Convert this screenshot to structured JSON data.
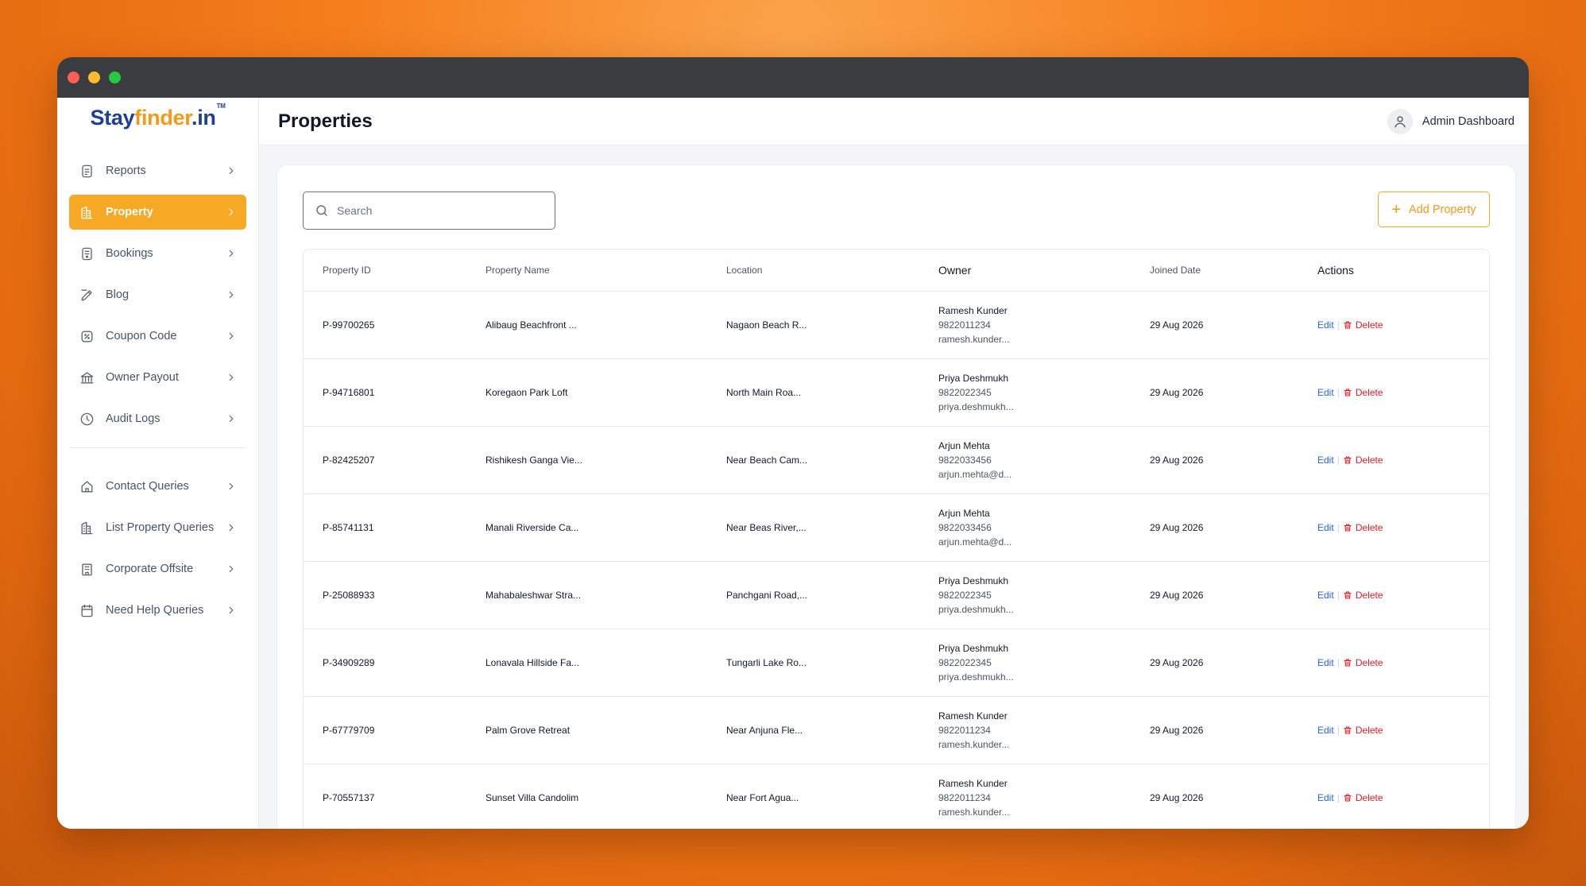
{
  "brand": {
    "part1": "Stay",
    "part2": "finder",
    "part3": ".in",
    "tm": "TM"
  },
  "sidebar": {
    "items": [
      {
        "label": "Reports",
        "icon": "report-icon"
      },
      {
        "label": "Property",
        "icon": "building-icon",
        "active": true
      },
      {
        "label": "Bookings",
        "icon": "booking-icon"
      },
      {
        "label": "Blog",
        "icon": "pen-icon"
      },
      {
        "label": "Coupon Code",
        "icon": "percent-icon"
      },
      {
        "label": "Owner Payout",
        "icon": "payout-icon"
      },
      {
        "label": "Audit Logs",
        "icon": "clock-icon"
      }
    ],
    "items2": [
      {
        "label": "Contact Queries",
        "icon": "home-icon"
      },
      {
        "label": "List Property Queries",
        "icon": "building-icon"
      },
      {
        "label": "Corporate Offsite",
        "icon": "office-icon"
      },
      {
        "label": "Need Help Queries",
        "icon": "calendar-icon"
      }
    ]
  },
  "header": {
    "title": "Properties",
    "user_label": "Admin Dashboard"
  },
  "search": {
    "placeholder": "Search"
  },
  "add_button": {
    "label": "Add Property"
  },
  "table": {
    "headers": [
      "Property ID",
      "Property Name",
      "Location",
      "Owner",
      "Joined Date",
      "Actions"
    ],
    "edit_label": "Edit",
    "sep": "|",
    "delete_label": "Delete",
    "rows": [
      {
        "id": "P-99700265",
        "name": "Alibaug Beachfront ...",
        "location": "Nagaon Beach R...",
        "owner": "Ramesh Kunder",
        "phone": "9822011234",
        "email": "ramesh.kunder...",
        "date": "29 Aug 2026"
      },
      {
        "id": "P-94716801",
        "name": "Koregaon Park Loft",
        "location": "North Main Roa...",
        "owner": "Priya Deshmukh",
        "phone": "9822022345",
        "email": "priya.deshmukh...",
        "date": "29 Aug 2026"
      },
      {
        "id": "P-82425207",
        "name": "Rishikesh Ganga Vie...",
        "location": "Near Beach Cam...",
        "owner": "Arjun Mehta",
        "phone": "9822033456",
        "email": "arjun.mehta@d...",
        "date": "29 Aug 2026"
      },
      {
        "id": "P-85741131",
        "name": "Manali Riverside Ca...",
        "location": "Near Beas River,...",
        "owner": "Arjun Mehta",
        "phone": "9822033456",
        "email": "arjun.mehta@d...",
        "date": "29 Aug 2026"
      },
      {
        "id": "P-25088933",
        "name": "Mahabaleshwar Stra...",
        "location": "Panchgani Road,...",
        "owner": "Priya Deshmukh",
        "phone": "9822022345",
        "email": "priya.deshmukh...",
        "date": "29 Aug 2026"
      },
      {
        "id": "P-34909289",
        "name": "Lonavala Hillside Fa...",
        "location": "Tungarli Lake Ro...",
        "owner": "Priya Deshmukh",
        "phone": "9822022345",
        "email": "priya.deshmukh...",
        "date": "29 Aug 2026"
      },
      {
        "id": "P-67779709",
        "name": "Palm Grove Retreat",
        "location": "Near Anjuna Fle...",
        "owner": "Ramesh Kunder",
        "phone": "9822011234",
        "email": "ramesh.kunder...",
        "date": "29 Aug 2026"
      },
      {
        "id": "P-70557137",
        "name": "Sunset Villa Candolim",
        "location": "Near Fort Agua...",
        "owner": "Ramesh Kunder",
        "phone": "9822011234",
        "email": "ramesh.kunder...",
        "date": "29 Aug 2026"
      }
    ]
  },
  "colors": {
    "accent": "#f7a825",
    "brand_blue": "#1e3f97",
    "edit": "#2563eb",
    "delete": "#e11d2a"
  }
}
